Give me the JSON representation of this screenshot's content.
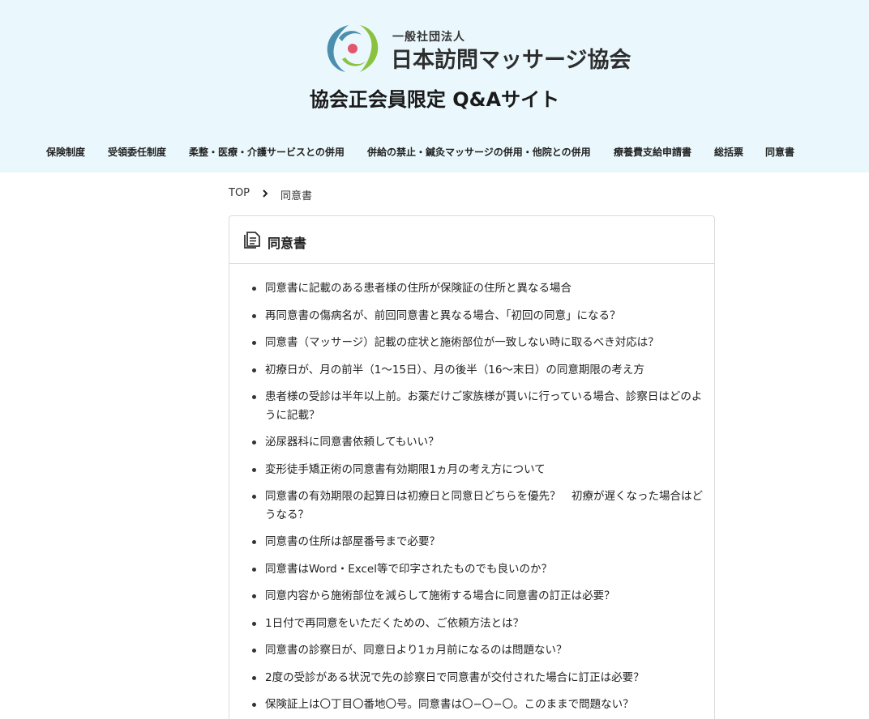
{
  "header": {
    "org_small": "一般社団法人",
    "org_name": "日本訪問マッサージ協会",
    "site_title": "協会正会員限定 Q&Aサイト",
    "logo_colors": {
      "blue": "#4a8fae",
      "green": "#8ac240",
      "dot": "#e2566e"
    }
  },
  "nav": {
    "items": [
      {
        "label": "保険制度"
      },
      {
        "label": "受領委任制度"
      },
      {
        "label": "柔整・医療・介護サービスとの併用"
      },
      {
        "label": "併給の禁止・鍼灸マッサージの併用・他院との併用"
      },
      {
        "label": "療養費支給申請書"
      },
      {
        "label": "総括票"
      },
      {
        "label": "同意書"
      }
    ]
  },
  "breadcrumb": {
    "top": "TOP",
    "separator_icon": "chevron-right-icon",
    "current": "同意書"
  },
  "card": {
    "icon": "document-icon",
    "title": "同意書",
    "questions": [
      "同意書に記載のある患者様の住所が保険証の住所と異なる場合",
      "再同意書の傷病名が、前回同意書と異なる場合、「初回の同意」になる？",
      "同意書（マッサージ）記載の症状と施術部位が一致しない時に取るべき対応は？",
      "初療日が、月の前半（1〜15日）、月の後半（16〜末日）の同意期限の考え方",
      "患者様の受診は半年以上前。お薬だけご家族様が貰いに行っている場合、診察日はどのように記載？",
      "泌尿器科に同意書依頼してもいい？",
      "変形徒手矯正術の同意書有効期限1ヵ月の考え方について",
      "同意書の有効期限の起算日は初療日と同意日どちらを優先？　初療が遅くなった場合はどうなる？",
      "同意書の住所は部屋番号まで必要？",
      "同意書はWord・Excel等で印字されたものでも良いのか？",
      "同意内容から施術部位を減らして施術する場合に同意書の訂正は必要？",
      "1日付で再同意をいただくための、ご依頼方法とは？",
      "同意書の診察日が、同意日より1ヵ月前になるのは問題ない？",
      "2度の受診がある状況で先の診察日で同意書が交付された場合に訂正は必要？",
      "保険証上は〇丁目〇番地〇号。同意書は〇−〇−〇。このままで問題ない？"
    ]
  }
}
